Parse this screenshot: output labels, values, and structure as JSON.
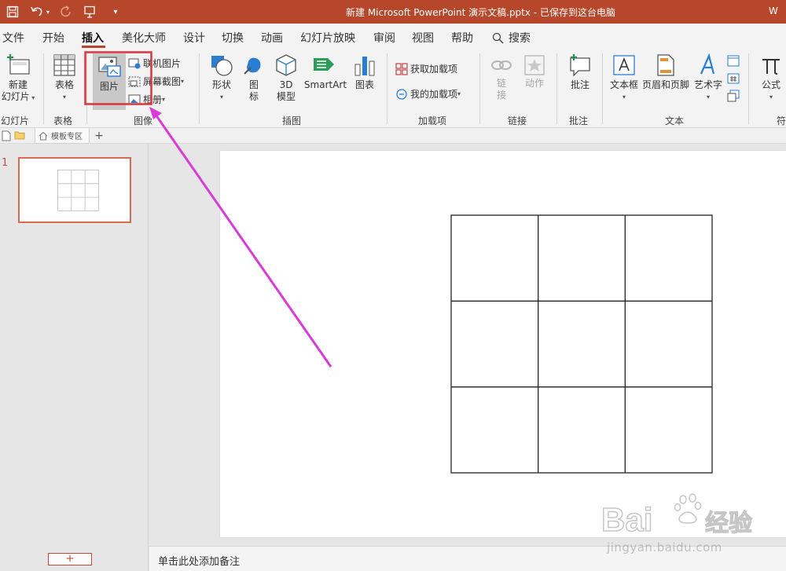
{
  "titlebar": {
    "doc_title": "新建 Microsoft PowerPoint 演示文稿.pptx  -  已保存到这台电脑",
    "right_text": "W"
  },
  "menu": {
    "tabs": [
      "文件",
      "开始",
      "插入",
      "美化大师",
      "设计",
      "切换",
      "动画",
      "幻灯片放映",
      "审阅",
      "视图",
      "帮助"
    ],
    "active_tab": "插入",
    "search_label": "搜索"
  },
  "ribbon": {
    "new_slide": [
      "新建",
      "幻灯片"
    ],
    "table": "表格",
    "picture": "图片",
    "online_picture": "联机图片",
    "screenshot": "屏幕截图",
    "album": "相册",
    "shapes": "形状",
    "icons": [
      "图",
      "标"
    ],
    "model3d": [
      "3D",
      "模型"
    ],
    "smartart": "SmartArt",
    "chart": "图表",
    "get_addins": "获取加载项",
    "my_addins": "我的加载项",
    "link": [
      "链",
      "接"
    ],
    "action": "动作",
    "comment": "批注",
    "textbox": "文本框",
    "header_footer": "页眉和页脚",
    "wordart": "艺术字",
    "equation": "公式",
    "groups": {
      "slides": "幻灯片",
      "tables": "表格",
      "images": "图像",
      "illustrations": "插图",
      "addins": "加载项",
      "links": "链接",
      "comments": "批注",
      "text": "文本",
      "symbols": "符"
    }
  },
  "docstrip": {
    "template_tab": "模板专区",
    "add_tab": "+"
  },
  "thumbnails": {
    "slide_number": "1",
    "add_button": "+"
  },
  "notes": {
    "placeholder": "单击此处添加备注"
  },
  "watermark": {
    "brand": "Bai",
    "brand_cn": "经验",
    "url": "jingyan.baidu.com"
  },
  "colors": {
    "accent": "#b7472a",
    "highlight_box": "#d9363e",
    "arrow": "#d93bd9"
  }
}
